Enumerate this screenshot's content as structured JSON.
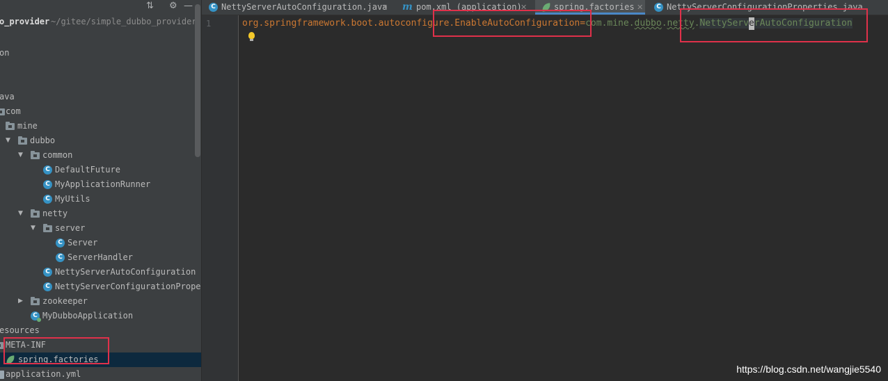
{
  "project_panel": {
    "root_name": "o_provider",
    "root_path": "~/gitee/simple_dubbo_provider",
    "tree": [
      {
        "label": "on"
      },
      {
        "label": "ava"
      },
      {
        "label": "com"
      },
      {
        "label": "mine"
      },
      {
        "label": "dubbo"
      },
      {
        "label": "common"
      },
      {
        "label": "DefaultFuture"
      },
      {
        "label": "MyApplicationRunner"
      },
      {
        "label": "MyUtils"
      },
      {
        "label": "netty"
      },
      {
        "label": "server"
      },
      {
        "label": "Server"
      },
      {
        "label": "ServerHandler"
      },
      {
        "label": "NettyServerAutoConfiguration"
      },
      {
        "label": "NettyServerConfigurationProper"
      },
      {
        "label": "zookeeper"
      },
      {
        "label": "MyDubboApplication"
      },
      {
        "label": "esources"
      },
      {
        "label": "META-INF"
      },
      {
        "label": "spring.factories"
      },
      {
        "label": "application.yml"
      }
    ]
  },
  "tabs": [
    {
      "label": "NettyServerAutoConfiguration.java",
      "icon": "class-icon"
    },
    {
      "label": "pom.xml (application)",
      "icon": "maven-icon"
    },
    {
      "label": "spring.factories",
      "icon": "spring-icon",
      "active": true
    },
    {
      "label": "NettyServerConfigurationProperties.java",
      "icon": "class-icon"
    }
  ],
  "editor": {
    "line_number": "1",
    "code": {
      "key_prefix": "org.springframework.boot.autoconfigure.",
      "key_class": "EnableAutoConfiguration",
      "equals": "=",
      "val_part1": "com.mine.",
      "val_dubbo": "dubbo",
      "val_dot": ".",
      "val_netty": "netty",
      "val_dot2": ".",
      "val_hl_before": "NettyServ",
      "val_caret_char": "e",
      "val_hl_after": "rAutoConfiguration"
    }
  },
  "watermark": "https://blog.csdn.net/wangjie5540",
  "colors": {
    "accent": "#4a88c7",
    "highlight_box": "#e0314a",
    "keyword": "#cc7832",
    "value": "#6a8759"
  }
}
